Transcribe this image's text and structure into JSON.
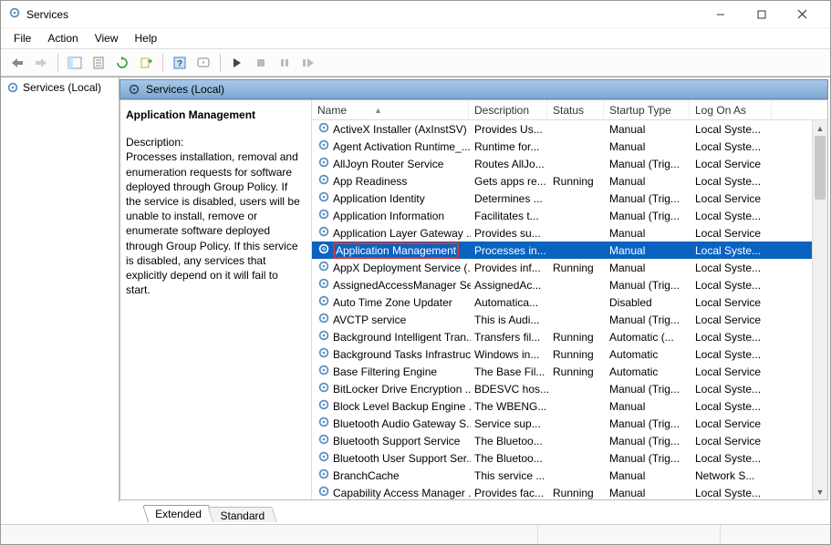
{
  "window": {
    "title": "Services"
  },
  "menubar": [
    "File",
    "Action",
    "View",
    "Help"
  ],
  "tree": {
    "root_label": "Services (Local)"
  },
  "right_header": "Services (Local)",
  "details": {
    "name": "Application Management",
    "desc_label": "Description:",
    "desc_body": "Processes installation, removal and enumeration requests for software deployed through Group Policy. If the service is disabled, users will be unable to install, remove or enumerate software deployed through Group Policy. If this service is disabled, any services that explicitly depend on it will fail to start."
  },
  "columns": {
    "name": "Name",
    "description": "Description",
    "status": "Status",
    "startup": "Startup Type",
    "logon": "Log On As"
  },
  "services": [
    {
      "name": "ActiveX Installer (AxInstSV)",
      "desc": "Provides Us...",
      "status": "",
      "startup": "Manual",
      "logon": "Local Syste...",
      "selected": false
    },
    {
      "name": "Agent Activation Runtime_...",
      "desc": "Runtime for...",
      "status": "",
      "startup": "Manual",
      "logon": "Local Syste...",
      "selected": false
    },
    {
      "name": "AllJoyn Router Service",
      "desc": "Routes AllJo...",
      "status": "",
      "startup": "Manual (Trig...",
      "logon": "Local Service",
      "selected": false
    },
    {
      "name": "App Readiness",
      "desc": "Gets apps re...",
      "status": "Running",
      "startup": "Manual",
      "logon": "Local Syste...",
      "selected": false
    },
    {
      "name": "Application Identity",
      "desc": "Determines ...",
      "status": "",
      "startup": "Manual (Trig...",
      "logon": "Local Service",
      "selected": false
    },
    {
      "name": "Application Information",
      "desc": "Facilitates t...",
      "status": "",
      "startup": "Manual (Trig...",
      "logon": "Local Syste...",
      "selected": false
    },
    {
      "name": "Application Layer Gateway ...",
      "desc": "Provides su...",
      "status": "",
      "startup": "Manual",
      "logon": "Local Service",
      "selected": false
    },
    {
      "name": "Application Management",
      "desc": "Processes in...",
      "status": "",
      "startup": "Manual",
      "logon": "Local Syste...",
      "selected": true,
      "redbox": true
    },
    {
      "name": "AppX Deployment Service (...",
      "desc": "Provides inf...",
      "status": "Running",
      "startup": "Manual",
      "logon": "Local Syste...",
      "selected": false
    },
    {
      "name": "AssignedAccessManager Se...",
      "desc": "AssignedAc...",
      "status": "",
      "startup": "Manual (Trig...",
      "logon": "Local Syste...",
      "selected": false
    },
    {
      "name": "Auto Time Zone Updater",
      "desc": "Automatica...",
      "status": "",
      "startup": "Disabled",
      "logon": "Local Service",
      "selected": false
    },
    {
      "name": "AVCTP service",
      "desc": "This is Audi...",
      "status": "",
      "startup": "Manual (Trig...",
      "logon": "Local Service",
      "selected": false
    },
    {
      "name": "Background Intelligent Tran...",
      "desc": "Transfers fil...",
      "status": "Running",
      "startup": "Automatic (...",
      "logon": "Local Syste...",
      "selected": false
    },
    {
      "name": "Background Tasks Infrastruc...",
      "desc": "Windows in...",
      "status": "Running",
      "startup": "Automatic",
      "logon": "Local Syste...",
      "selected": false
    },
    {
      "name": "Base Filtering Engine",
      "desc": "The Base Fil...",
      "status": "Running",
      "startup": "Automatic",
      "logon": "Local Service",
      "selected": false
    },
    {
      "name": "BitLocker Drive Encryption ...",
      "desc": "BDESVC hos...",
      "status": "",
      "startup": "Manual (Trig...",
      "logon": "Local Syste...",
      "selected": false
    },
    {
      "name": "Block Level Backup Engine ...",
      "desc": "The WBENG...",
      "status": "",
      "startup": "Manual",
      "logon": "Local Syste...",
      "selected": false
    },
    {
      "name": "Bluetooth Audio Gateway S...",
      "desc": "Service sup...",
      "status": "",
      "startup": "Manual (Trig...",
      "logon": "Local Service",
      "selected": false
    },
    {
      "name": "Bluetooth Support Service",
      "desc": "The Bluetoo...",
      "status": "",
      "startup": "Manual (Trig...",
      "logon": "Local Service",
      "selected": false
    },
    {
      "name": "Bluetooth User Support Ser...",
      "desc": "The Bluetoo...",
      "status": "",
      "startup": "Manual (Trig...",
      "logon": "Local Syste...",
      "selected": false
    },
    {
      "name": "BranchCache",
      "desc": "This service ...",
      "status": "",
      "startup": "Manual",
      "logon": "Network S...",
      "selected": false
    },
    {
      "name": "Capability Access Manager ...",
      "desc": "Provides fac...",
      "status": "Running",
      "startup": "Manual",
      "logon": "Local Syste...",
      "selected": false
    }
  ],
  "tabs": {
    "extended": "Extended",
    "standard": "Standard"
  }
}
